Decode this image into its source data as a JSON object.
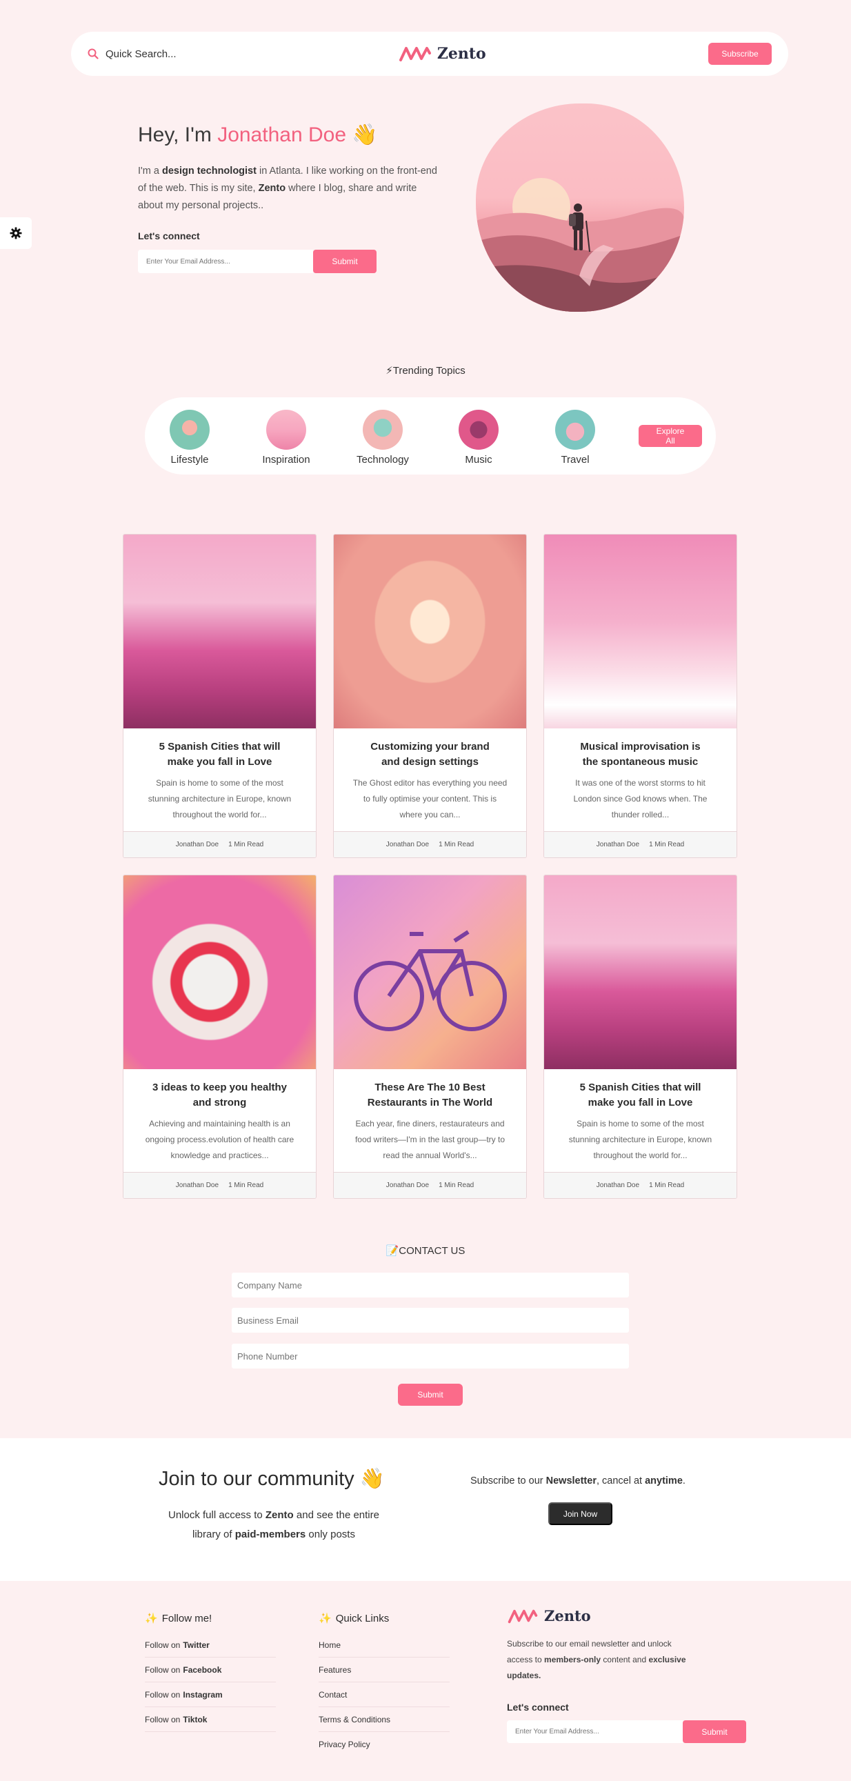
{
  "header": {
    "search_label": "Quick Search...",
    "logo_text": "Zento",
    "subscribe_label": "Subscribe"
  },
  "hero": {
    "greeting": "Hey, I'm ",
    "name": "Jonathan Doe",
    "wave": "👋",
    "intro_1": "I'm a ",
    "intro_bold_1": "design technologist",
    "intro_2": " in Atlanta. I like working on the front-end of the web. This is my site, ",
    "intro_bold_2": "Zento",
    "intro_3": " where I blog, share and write about my personal projects..",
    "connect_label": "Let's connect",
    "email_placeholder": "Enter Your Email Address...",
    "submit_label": "Submit"
  },
  "trending": {
    "title": "Trending Topics",
    "topics": [
      {
        "label": "Lifestyle"
      },
      {
        "label": "Inspiration"
      },
      {
        "label": "Technology"
      },
      {
        "label": "Music"
      },
      {
        "label": "Travel"
      }
    ],
    "explore_label": "Explore All"
  },
  "posts": [
    {
      "title": "5 Spanish Cities that will make you fall in Love",
      "excerpt": "Spain is home to some of the most stunning architecture in Europe, known throughout the world for...",
      "author": "Jonathan Doe",
      "read": "1 Min Read"
    },
    {
      "title": "Customizing your brand and design settings",
      "excerpt": "The Ghost editor has everything you need to fully optimise your content. This is where you can...",
      "author": "Jonathan Doe",
      "read": "1 Min Read"
    },
    {
      "title": "Musical improvisation is the spontaneous music",
      "excerpt": "It was one of the worst storms to hit London since God knows when. The thunder rolled...",
      "author": "Jonathan Doe",
      "read": "1 Min Read"
    },
    {
      "title": "3 ideas to keep you healthy and strong",
      "excerpt": "Achieving and maintaining health is an ongoing process.evolution of health care knowledge and practices...",
      "author": "Jonathan Doe",
      "read": "1 Min Read"
    },
    {
      "title": "These Are The 10 Best Restaurants in The World",
      "excerpt": "Each year, fine diners, restaurateurs and food writers—I'm in the last group—try to read the annual World's...",
      "author": "Jonathan Doe",
      "read": "1 Min Read"
    },
    {
      "title": "5 Spanish Cities that will make you fall in Love",
      "excerpt": "Spain is home to some of the most stunning architecture in Europe, known throughout the world for...",
      "author": "Jonathan Doe",
      "read": "1 Min Read"
    }
  ],
  "contact": {
    "title": "CONTACT US",
    "company_placeholder": "Company Name",
    "email_placeholder": "Business Email",
    "phone_placeholder": "Phone Number",
    "submit_label": "Submit"
  },
  "community": {
    "title": "Join to our community",
    "wave": "👋",
    "sub_1": "Unlock full access to ",
    "sub_bold_1": "Zento",
    "sub_2": " and see the entire library of ",
    "sub_bold_2": "paid-members",
    "sub_3": " only posts",
    "right_1": "Subscribe to our ",
    "right_bold_1": "Newsletter",
    "right_2": ", cancel at ",
    "right_bold_2": "anytime",
    "right_3": ".",
    "join_label": "Join Now"
  },
  "footer": {
    "follow_title": "Follow me!",
    "follow_prefix": "Follow on",
    "follow_items": [
      "Twitter",
      "Facebook",
      "Instagram",
      "Tiktok"
    ],
    "links_title": "Quick Links",
    "links": [
      "Home",
      "Features",
      "Contact",
      "Terms & Conditions",
      "Privacy Policy"
    ],
    "logo_text": "Zento",
    "text_1": "Subscribe to our email newsletter and unlock access to ",
    "text_bold_1": "members-only",
    "text_2": " content and ",
    "text_bold_2": "exclusive updates.",
    "connect_label": "Let's connect",
    "email_placeholder": "Enter Your Email Address...",
    "submit_label": "Submit"
  },
  "colors": {
    "accent": "#fb6b8a",
    "background": "#fdf0f1",
    "dark_button": "#2c2c2c"
  }
}
